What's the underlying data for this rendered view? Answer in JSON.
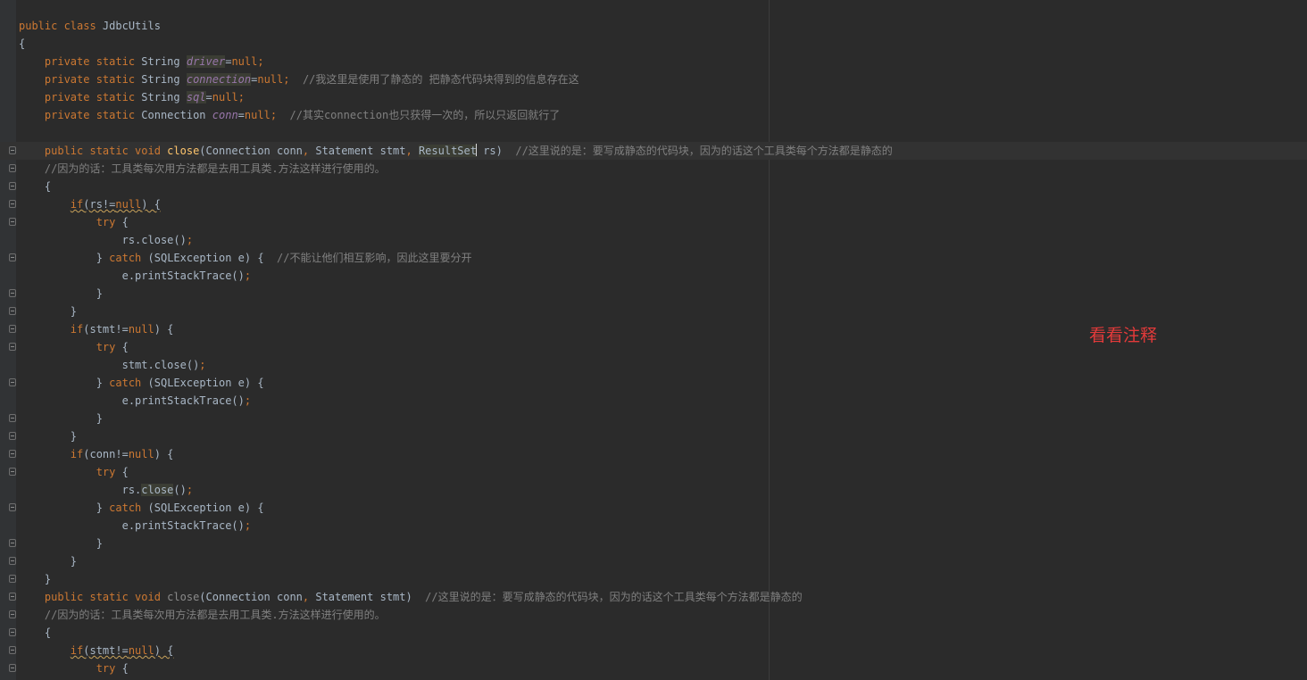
{
  "editor": {
    "language": "java",
    "current_line": 8,
    "colors": {
      "background": "#2b2b2b",
      "keyword": "#cc7832",
      "method": "#ffc66d",
      "field": "#9876aa",
      "comment": "#808080",
      "default": "#a9b7c6",
      "annotation": "#e43a3a"
    },
    "lines": [
      {
        "fold": false,
        "tokens": [
          {
            "t": "public class ",
            "c": "kw"
          },
          {
            "t": "JdbcUtils"
          }
        ]
      },
      {
        "fold": false,
        "tokens": [
          {
            "t": "{"
          }
        ]
      },
      {
        "fold": false,
        "tokens": [
          {
            "t": "    private static ",
            "c": "kw"
          },
          {
            "t": "String "
          },
          {
            "t": "driver",
            "c": "fld hl"
          },
          {
            "t": "="
          },
          {
            "t": "null",
            "c": "kw"
          },
          {
            "t": ";",
            "c": "kw"
          }
        ]
      },
      {
        "fold": false,
        "tokens": [
          {
            "t": "    private static ",
            "c": "kw"
          },
          {
            "t": "String "
          },
          {
            "t": "connection",
            "c": "fld hl"
          },
          {
            "t": "="
          },
          {
            "t": "null",
            "c": "kw"
          },
          {
            "t": ";  ",
            "c": "kw"
          },
          {
            "t": "//我这里是使用了静态的 把静态代码块得到的信息存在这",
            "c": "cmt"
          }
        ]
      },
      {
        "fold": false,
        "tokens": [
          {
            "t": "    private static ",
            "c": "kw"
          },
          {
            "t": "String "
          },
          {
            "t": "sql",
            "c": "fld hl"
          },
          {
            "t": "="
          },
          {
            "t": "null",
            "c": "kw"
          },
          {
            "t": ";",
            "c": "kw"
          }
        ]
      },
      {
        "fold": false,
        "tokens": [
          {
            "t": "    private static ",
            "c": "kw"
          },
          {
            "t": "Connection "
          },
          {
            "t": "conn",
            "c": "fld"
          },
          {
            "t": "="
          },
          {
            "t": "null",
            "c": "kw"
          },
          {
            "t": ";  ",
            "c": "kw"
          },
          {
            "t": "//其实connection也只获得一次的，所以只返回就行了",
            "c": "cmt"
          }
        ]
      },
      {
        "fold": false,
        "tokens": []
      },
      {
        "fold": true,
        "tokens": [
          {
            "t": "    public static void ",
            "c": "kw"
          },
          {
            "t": "close",
            "c": "fn"
          },
          {
            "t": "(Connection conn"
          },
          {
            "t": ", ",
            "c": "kw"
          },
          {
            "t": "Statement stmt"
          },
          {
            "t": ", ",
            "c": "kw"
          },
          {
            "t": "ResultSet",
            "c": "hl"
          },
          {
            "caret": true
          },
          {
            "t": " rs)  "
          },
          {
            "t": "//这里说的是：要写成静态的代码块，因为的话这个工具类每个方法都是静态的",
            "c": "cmt"
          }
        ]
      },
      {
        "fold": true,
        "tokens": [
          {
            "t": "    //因为的话：工具类每次用方法都是去用工具类.方法这样进行使用的。",
            "c": "cmt"
          }
        ]
      },
      {
        "fold": true,
        "tokens": [
          {
            "t": "    {"
          }
        ]
      },
      {
        "fold": true,
        "tokens": [
          {
            "t": "        "
          },
          {
            "t": "if",
            "c": "kw err"
          },
          {
            "t": "(rs!=",
            "c": "err"
          },
          {
            "t": "null",
            "c": "kw err"
          },
          {
            "t": ") {",
            "c": "err"
          }
        ]
      },
      {
        "fold": true,
        "tokens": [
          {
            "t": "            "
          },
          {
            "t": "try ",
            "c": "kw"
          },
          {
            "t": "{"
          }
        ]
      },
      {
        "fold": false,
        "tokens": [
          {
            "t": "                rs.close()"
          },
          {
            "t": ";",
            "c": "kw"
          }
        ]
      },
      {
        "fold": true,
        "tokens": [
          {
            "t": "            } "
          },
          {
            "t": "catch ",
            "c": "kw"
          },
          {
            "t": "(SQLException e) {  "
          },
          {
            "t": "//不能让他们相互影响，因此这里要分开",
            "c": "cmt"
          }
        ]
      },
      {
        "fold": false,
        "tokens": [
          {
            "t": "                e.printStackTrace()"
          },
          {
            "t": ";",
            "c": "kw"
          }
        ]
      },
      {
        "fold": true,
        "tokens": [
          {
            "t": "            }"
          }
        ]
      },
      {
        "fold": true,
        "tokens": [
          {
            "t": "        }"
          }
        ]
      },
      {
        "fold": true,
        "tokens": [
          {
            "t": "        "
          },
          {
            "t": "if",
            "c": "kw"
          },
          {
            "t": "(stmt!="
          },
          {
            "t": "null",
            "c": "kw"
          },
          {
            "t": ") {"
          }
        ]
      },
      {
        "fold": true,
        "tokens": [
          {
            "t": "            "
          },
          {
            "t": "try ",
            "c": "kw"
          },
          {
            "t": "{"
          }
        ]
      },
      {
        "fold": false,
        "tokens": [
          {
            "t": "                stmt.close()"
          },
          {
            "t": ";",
            "c": "kw"
          }
        ]
      },
      {
        "fold": true,
        "tokens": [
          {
            "t": "            } "
          },
          {
            "t": "catch ",
            "c": "kw"
          },
          {
            "t": "(SQLException e) {"
          }
        ]
      },
      {
        "fold": false,
        "tokens": [
          {
            "t": "                e.printStackTrace()"
          },
          {
            "t": ";",
            "c": "kw"
          }
        ]
      },
      {
        "fold": true,
        "tokens": [
          {
            "t": "            }"
          }
        ]
      },
      {
        "fold": true,
        "tokens": [
          {
            "t": "        }"
          }
        ]
      },
      {
        "fold": true,
        "tokens": [
          {
            "t": "        "
          },
          {
            "t": "if",
            "c": "kw"
          },
          {
            "t": "(conn!="
          },
          {
            "t": "null",
            "c": "kw"
          },
          {
            "t": ") {"
          }
        ]
      },
      {
        "fold": true,
        "tokens": [
          {
            "t": "            "
          },
          {
            "t": "try ",
            "c": "kw"
          },
          {
            "t": "{"
          }
        ]
      },
      {
        "fold": false,
        "tokens": [
          {
            "t": "                rs."
          },
          {
            "t": "close",
            "c": "hl"
          },
          {
            "t": "()"
          },
          {
            "t": ";",
            "c": "kw"
          }
        ]
      },
      {
        "fold": true,
        "tokens": [
          {
            "t": "            } "
          },
          {
            "t": "catch ",
            "c": "kw"
          },
          {
            "t": "(SQLException e) {"
          }
        ]
      },
      {
        "fold": false,
        "tokens": [
          {
            "t": "                e.printStackTrace()"
          },
          {
            "t": ";",
            "c": "kw"
          }
        ]
      },
      {
        "fold": true,
        "tokens": [
          {
            "t": "            }"
          }
        ]
      },
      {
        "fold": true,
        "tokens": [
          {
            "t": "        }"
          }
        ]
      },
      {
        "fold": true,
        "tokens": [
          {
            "t": "    }"
          }
        ]
      },
      {
        "fold": true,
        "tokens": [
          {
            "t": "    public static void ",
            "c": "kw"
          },
          {
            "t": "close",
            "c": "gray"
          },
          {
            "t": "(Connection conn"
          },
          {
            "t": ", ",
            "c": "kw"
          },
          {
            "t": "Statement stmt)  "
          },
          {
            "t": "//这里说的是：要写成静态的代码块，因为的话这个工具类每个方法都是静态的",
            "c": "cmt"
          }
        ]
      },
      {
        "fold": true,
        "tokens": [
          {
            "t": "    //因为的话：工具类每次用方法都是去用工具类.方法这样进行使用的。",
            "c": "cmt"
          }
        ]
      },
      {
        "fold": true,
        "tokens": [
          {
            "t": "    {"
          }
        ]
      },
      {
        "fold": true,
        "tokens": [
          {
            "t": "        "
          },
          {
            "t": "if",
            "c": "kw err"
          },
          {
            "t": "(stmt!=",
            "c": "err"
          },
          {
            "t": "null",
            "c": "kw err"
          },
          {
            "t": ") {",
            "c": "err"
          }
        ]
      },
      {
        "fold": true,
        "tokens": [
          {
            "t": "            "
          },
          {
            "t": "try ",
            "c": "kw"
          },
          {
            "t": "{"
          }
        ]
      }
    ]
  },
  "annotation": {
    "text": "看看注释"
  }
}
